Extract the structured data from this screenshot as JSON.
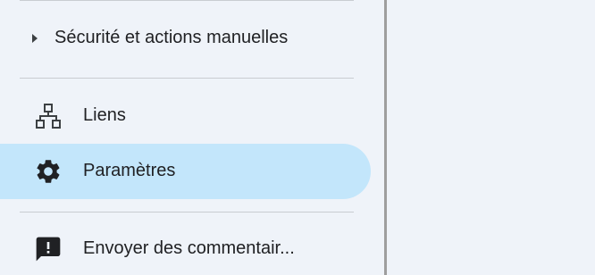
{
  "sidebar": {
    "section": {
      "label": "Sécurité et actions manuelles",
      "icon": "caret-right-icon"
    },
    "items": [
      {
        "label": "Liens",
        "icon": "sitemap-icon",
        "active": false
      },
      {
        "label": "Paramètres",
        "icon": "gear-icon",
        "active": true
      },
      {
        "label": "Envoyer des commentair...",
        "icon": "feedback-icon",
        "active": false
      }
    ]
  },
  "colors": {
    "background": "#eff3f9",
    "active_item": "#c3e6fb",
    "splitter": "#9e9e9e",
    "divider": "#c9ccd1",
    "text": "#202124"
  }
}
